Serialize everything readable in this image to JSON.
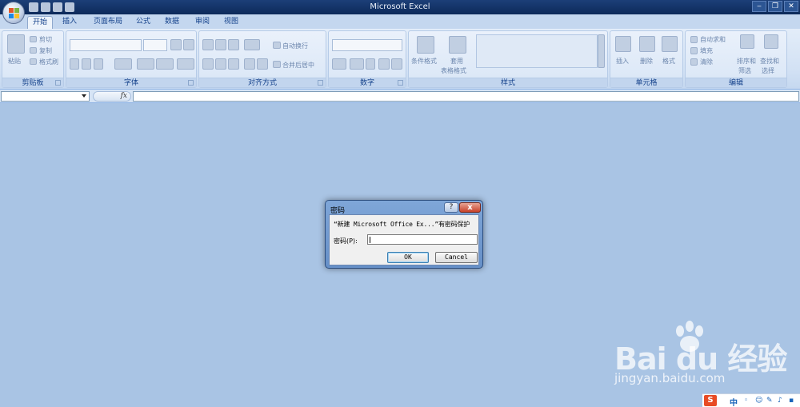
{
  "window": {
    "title": "Microsoft Excel",
    "controls": {
      "minimize": "‒",
      "restore": "❐",
      "close": "✕"
    }
  },
  "tabs": [
    {
      "label": "开始",
      "active": true
    },
    {
      "label": "插入"
    },
    {
      "label": "页面布局"
    },
    {
      "label": "公式"
    },
    {
      "label": "数据"
    },
    {
      "label": "审阅"
    },
    {
      "label": "视图"
    }
  ],
  "ribbon": {
    "clipboard": {
      "label": "剪贴板",
      "paste": "粘贴",
      "cut": "剪切",
      "copy": "复制",
      "format_painter": "格式刷"
    },
    "font": {
      "label": "字体"
    },
    "alignment": {
      "label": "对齐方式",
      "wrap_text": "自动换行",
      "merge_center": "合并后居中"
    },
    "number": {
      "label": "数字"
    },
    "styles": {
      "label": "样式",
      "conditional_formatting": "条件格式",
      "format_as_table_line1": "套用",
      "format_as_table_line2": "表格格式"
    },
    "cells": {
      "label": "单元格",
      "insert": "插入",
      "delete": "删除",
      "format": "格式"
    },
    "editing": {
      "label": "编辑",
      "autosum": "自动求和",
      "fill": "填充",
      "clear": "清除",
      "sort_filter_line1": "排序和",
      "sort_filter_line2": "筛选",
      "find_select_line1": "查找和",
      "find_select_line2": "选择"
    }
  },
  "formula_bar": {
    "fx": "fx"
  },
  "dialog": {
    "title": "密码",
    "help": "?",
    "close": "x",
    "message": "“新建 Microsoft Office Ex...”有密码保护",
    "password_label": "密码(P):",
    "ok_label": "OK",
    "cancel_label": "Cancel"
  },
  "watermark": {
    "brand": "Bai du 经验",
    "url": "jingyan.baidu.com"
  },
  "ime": {
    "logo": "S",
    "mode": "中"
  },
  "colors": {
    "workspace": "#a9c4e4",
    "title_bar": "#1c3f78",
    "ribbon": "#d2e1f4",
    "dialog_frame": "#6690c8",
    "close_button": "#c7422a"
  }
}
